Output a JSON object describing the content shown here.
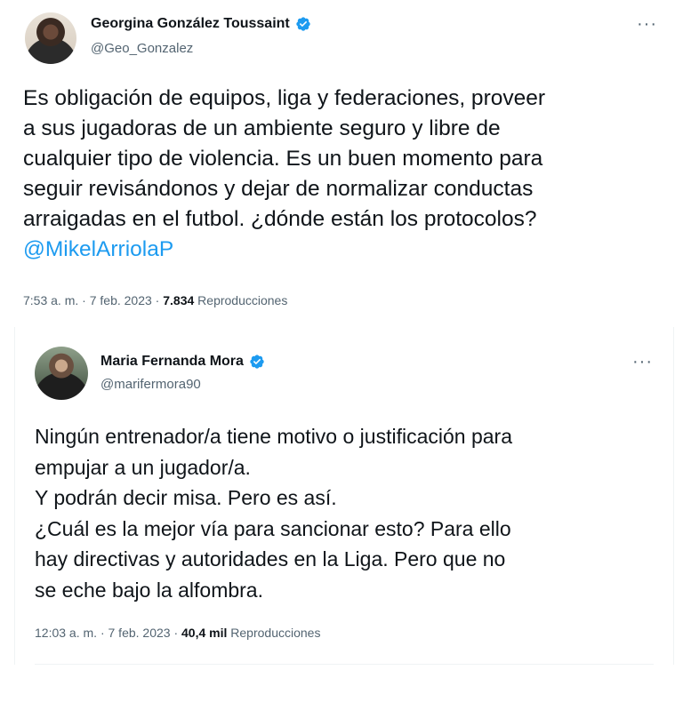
{
  "colors": {
    "text": "#0f1419",
    "secondary": "#536471",
    "accent": "#1d9bf0",
    "verified": "#1d9bf0"
  },
  "tweets": [
    {
      "author_name": "Georgina González Toussaint",
      "handle": "@Geo_Gonzalez",
      "more_icon": "more-horizontal-icon",
      "verified_icon": "verified-badge-icon",
      "text_lines": [
        "Es obligación de equipos, liga y federaciones, proveer",
        "a sus jugadoras de un ambiente seguro y libre de",
        "cualquier tipo de violencia. Es un buen momento para",
        "seguir revisándonos y dejar de normalizar conductas",
        "arraigadas en el futbol. ¿dónde están los protocolos?"
      ],
      "mention": "@MikelArriolaP",
      "time": "7:53 a. m.",
      "separator": "·",
      "date": "7 feb. 2023",
      "views": "7.834",
      "views_label": "Reproducciones"
    },
    {
      "author_name": "Maria Fernanda Mora",
      "handle": "@marifermora90",
      "more_icon": "more-horizontal-icon",
      "verified_icon": "verified-badge-icon",
      "text_lines": [
        "Ningún entrenador/a tiene motivo o justificación para",
        "empujar a un jugador/a.",
        "Y podrán decir misa. Pero es así.",
        "¿Cuál es la mejor vía para sancionar esto? Para ello",
        "hay directivas y autoridades en la Liga. Pero que no",
        "se eche bajo la alfombra."
      ],
      "time": "12:03 a. m.",
      "separator": "·",
      "date": "7 feb. 2023",
      "views": "40,4 mil",
      "views_label": "Reproducciones"
    }
  ]
}
